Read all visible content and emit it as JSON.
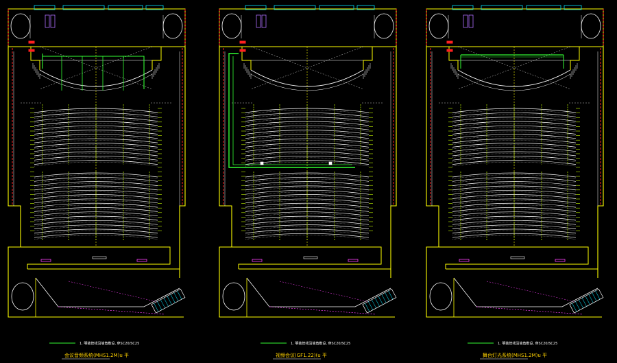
{
  "drawing": {
    "background": "#000000",
    "colors": {
      "wall": "#ffff00",
      "outline": "#ffffff",
      "seat": "#ffffff",
      "seat_dim": "#c8c8c8",
      "aisle": "#c8ff00",
      "cyan": "#00e5ff",
      "red": "#ff2020",
      "magenta": "#ff40ff",
      "green": "#33ff33",
      "purple": "#b070ff",
      "title": "#ffd200"
    },
    "plans": [
      {
        "key": "plan-1",
        "note": "1. 明装管线沿墙角敷设, 穿SC20/SC25",
        "title": "会议音频系统(MHS1.2M)u 平",
        "green_run": "stage-grid"
      },
      {
        "key": "plan-2",
        "note": "1. 明装管线沿墙角敷设, 穿SC20/SC25",
        "title": "视频会议(GF1.22)(u 平",
        "green_run": "side-trunk"
      },
      {
        "key": "plan-3",
        "note": "1. 明装管线沿墙角敷设, 穿SC20/SC25",
        "title": "舞台灯光系统(MHS1.2M)u 平",
        "green_run": "stage-bar"
      }
    ]
  }
}
